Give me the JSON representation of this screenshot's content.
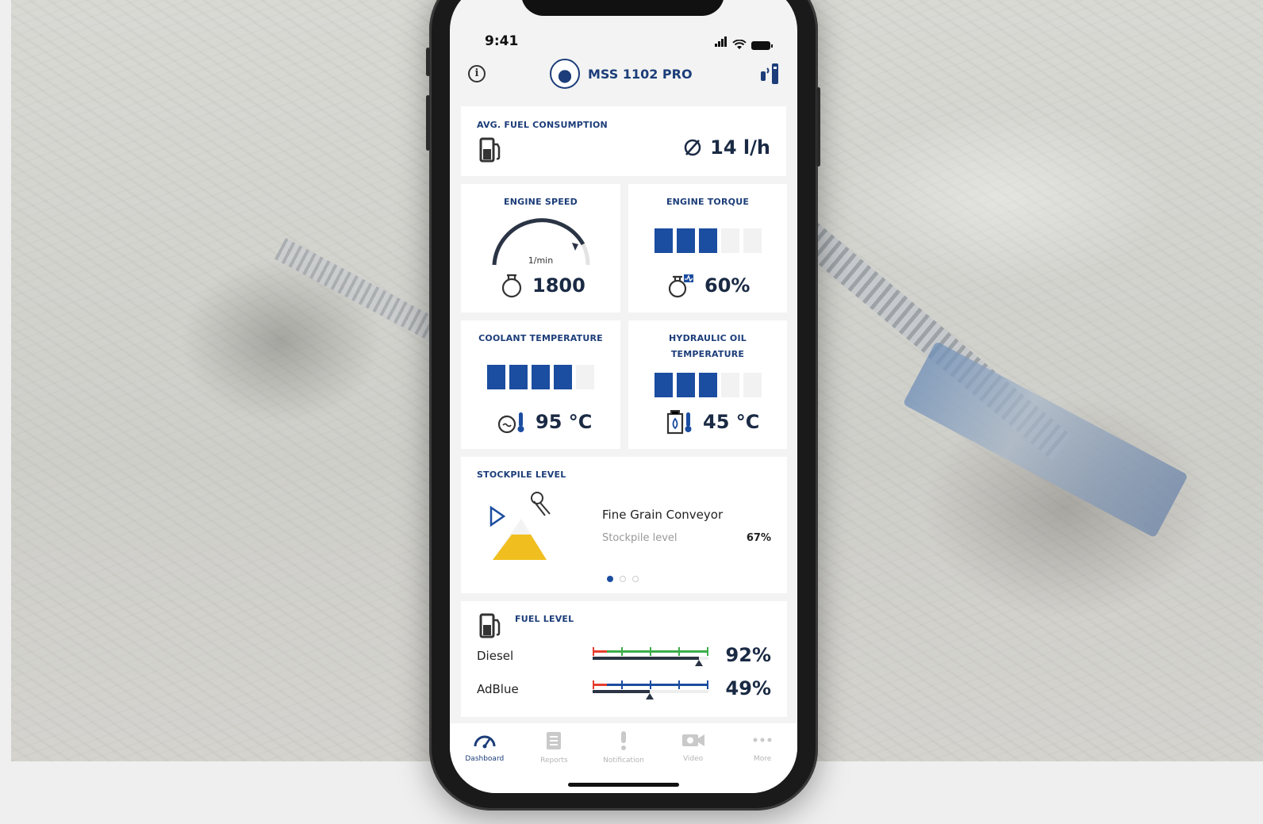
{
  "status": {
    "time": "9:41"
  },
  "header": {
    "machine": "MSS 1102 PRO"
  },
  "fuel_consumption": {
    "label": "AVG. FUEL CONSUMPTION",
    "value": "14 l/h"
  },
  "engine_speed": {
    "label": "ENGINE SPEED",
    "unit": "1/min",
    "value": "1800"
  },
  "engine_torque": {
    "label": "ENGINE TORQUE",
    "value": "60%",
    "level": 0.6
  },
  "coolant": {
    "label": "COOLANT TEMPERATURE",
    "value": "95 °C",
    "level": 0.8
  },
  "hydraulic": {
    "label_line1": "HYDRAULIC OIL",
    "label_line2": "TEMPERATURE",
    "value": "45 °C",
    "level": 0.6
  },
  "stockpile": {
    "label": "STOCKPILE LEVEL",
    "title": "Fine Grain Conveyor",
    "subtitle": "Stockpile level",
    "value": "67%"
  },
  "fuel_level": {
    "label": "FUEL LEVEL",
    "diesel": {
      "name": "Diesel",
      "value": "92%",
      "level": 0.92
    },
    "adblue": {
      "name": "AdBlue",
      "value": "49%",
      "level": 0.49
    }
  },
  "tabs": [
    {
      "label": "Dashboard"
    },
    {
      "label": "Reports"
    },
    {
      "label": "Notification"
    },
    {
      "label": "Video"
    },
    {
      "label": "More"
    }
  ],
  "colors": {
    "brand": "#1c3d79",
    "bar_on": "#1b4da0",
    "stockpile": "#f0be1e",
    "gauge_red": "#e53d2e",
    "gauge_green": "#3cae4a"
  }
}
